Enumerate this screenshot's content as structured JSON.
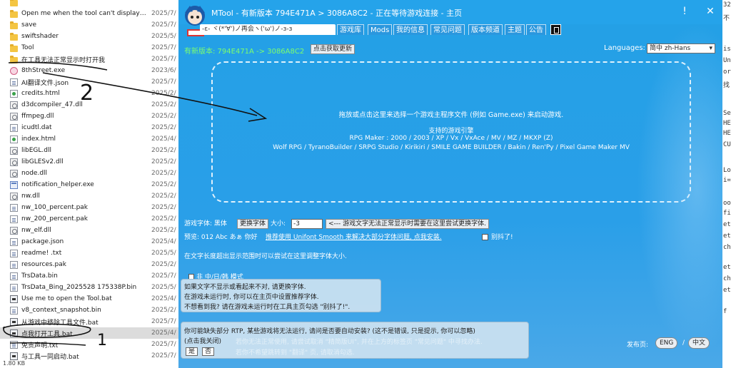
{
  "explorer": {
    "files": [
      {
        "name": "",
        "date": "",
        "type": "folder"
      },
      {
        "name": "Open me when the tool can't display ...",
        "date": "2025/7/",
        "type": "folder"
      },
      {
        "name": "save",
        "date": "2025/7/",
        "type": "folder"
      },
      {
        "name": "swiftshader",
        "date": "2025/5/",
        "type": "folder"
      },
      {
        "name": "Tool",
        "date": "2025/7/",
        "type": "folder"
      },
      {
        "name": "在工具无法正常显示时打开我",
        "date": "2025/7/",
        "type": "folder"
      },
      {
        "name": "8thStreet.exe",
        "date": "2023/6/",
        "type": "exe-pink"
      },
      {
        "name": "AI翻译文件.json",
        "date": "2025/7/",
        "type": "file"
      },
      {
        "name": "credits.html",
        "date": "2025/2/",
        "type": "html"
      },
      {
        "name": "d3dcompiler_47.dll",
        "date": "2025/2/",
        "type": "dll"
      },
      {
        "name": "ffmpeg.dll",
        "date": "2025/2/",
        "type": "dll"
      },
      {
        "name": "icudtl.dat",
        "date": "2025/2/",
        "type": "file"
      },
      {
        "name": "index.html",
        "date": "2025/4/",
        "type": "html"
      },
      {
        "name": "libEGL.dll",
        "date": "2025/2/",
        "type": "dll"
      },
      {
        "name": "libGLESv2.dll",
        "date": "2025/2/",
        "type": "dll"
      },
      {
        "name": "node.dll",
        "date": "2025/2/",
        "type": "dll"
      },
      {
        "name": "notification_helper.exe",
        "date": "2025/2/",
        "type": "exe"
      },
      {
        "name": "nw.dll",
        "date": "2025/2/",
        "type": "dll"
      },
      {
        "name": "nw_100_percent.pak",
        "date": "2025/2/",
        "type": "file"
      },
      {
        "name": "nw_200_percent.pak",
        "date": "2025/2/",
        "type": "file"
      },
      {
        "name": "nw_elf.dll",
        "date": "2025/2/",
        "type": "dll"
      },
      {
        "name": "package.json",
        "date": "2025/4/",
        "type": "file"
      },
      {
        "name": "readme! .txt",
        "date": "2025/5/",
        "type": "file"
      },
      {
        "name": "resources.pak",
        "date": "2025/2/",
        "type": "file"
      },
      {
        "name": "TrsData.bin",
        "date": "2025/7/",
        "type": "file"
      },
      {
        "name": "TrsData_Bing_2025528 175338P.bin",
        "date": "2025/5/",
        "type": "file"
      },
      {
        "name": "Use me to open the Tool.bat",
        "date": "2025/4/",
        "type": "bat"
      },
      {
        "name": "v8_context_snapshot.bin",
        "date": "2025/2/",
        "type": "file"
      },
      {
        "name": "从游戏中移除工具文件.bat",
        "date": "2025/7/",
        "type": "bat"
      },
      {
        "name": "点我打开工具.bat",
        "date": "2025/4/",
        "type": "bat"
      },
      {
        "name": "免责声明.txt",
        "date": "2025/7/",
        "type": "file"
      },
      {
        "name": "与工具一同启动.bat",
        "date": "2025/7/",
        "type": "bat"
      }
    ],
    "selected_index": 29,
    "status_size": "1.80 KB"
  },
  "mtool": {
    "window_title": "MTool - 有新版本 794E471A > 3086A8C2 - 正在等待游戏连接 - 主页",
    "kaomoji_tab": "-ε- ヾ(*'∀')ノ再会ヽ('ω')ノ-з-з",
    "tabs": [
      "游戏库",
      "Mods",
      "我的信息",
      "常见问题",
      "版本频道",
      "主题",
      "公告"
    ],
    "update_label": "有新版本: 794E471A -> 3086A8C2",
    "update_button": "点击获取更新",
    "languages_label": "Languages:",
    "language_selected": "简中 zh-Hans",
    "dropzone": {
      "line1": "拖放或点击这里来选择一个游戏主程序文件 (例如 Game.exe) 来启动游戏.",
      "line2": "支持的游戏引擎",
      "line3": "RPG Maker : 2000 / 2003 / XP / Vx / VxAce / MV / MZ / MKXP (Z)",
      "line4": "Wolf RPG / TyranoBuilder / SRPG Studio / Kirikiri / SMILE GAME BUILDER / Bakin / Ren'Py / Pixel Game Maker MV"
    },
    "font_row": {
      "font_label": "游戏字体: 黑体",
      "change_font_button": "更换字体",
      "size_label": "大小:",
      "size_value": "-3",
      "font_hint": "<--- 游戏文字无法正常显示时需要在这里尝试更换字体."
    },
    "preview_row": {
      "preview_text": "预览: 012 Abc あぁ 你好",
      "unifont_link": "推荐使用 Unifont Smooth 来解决大部分字体问题, 点我安装.",
      "dont_care_label": "别抖了!"
    },
    "resize_hint": "在文字长度超出显示范围时可以尝试在这里调整字体大小.",
    "mode_label": "非 中/日/韩 模式",
    "tip_font": [
      "如果文字不显示或看起来不对, 请更换字体.",
      "在游戏未运行时, 你可以在主页中设置推荐字体.",
      "不想看到我? 请在游戏未运行时在工具主页勾选 \"别抖了!\"."
    ],
    "tip_rtp": {
      "line1": "你可能缺失部分 RTP, 某些游戏将无法运行, 请问是否要自动安装? (这不是错误, 只是提示, 你可以忽略)",
      "line2": "(点击我关闭)",
      "faded1": "若你无法正常使用, 请尝试取消 \"精简版UI\", 并在上方的标签页 \"常见问题\" 中寻找办法.",
      "faded2": "若你不希望跳转到 \"翻译\" 页, 请取消勾选.",
      "yes": "是",
      "no": "否"
    },
    "publish_label": "发布页:",
    "publish_eng": "ENG",
    "publish_sep": "/",
    "publish_cn": "中文"
  },
  "background_text": [
    "32",
    "不",
    "is",
    "Un",
    "or",
    "找",
    "Se",
    "HE",
    "HE",
    "CU",
    "Lo",
    "i=",
    "oo",
    "fi",
    "et",
    "et",
    "ch",
    "et",
    "ch",
    "et",
    "f"
  ],
  "annotations": {
    "number_2": "2",
    "number_1": "1"
  }
}
